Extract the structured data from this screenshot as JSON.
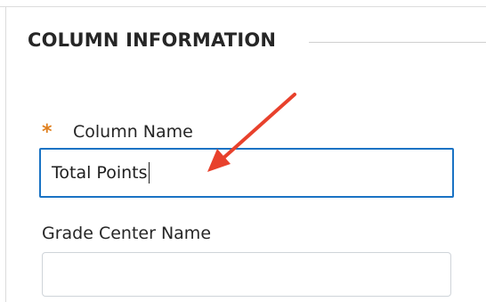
{
  "section": {
    "title": "COLUMN INFORMATION"
  },
  "fields": {
    "column_name": {
      "required_marker": "*",
      "label": "Column Name",
      "value": "Total Points"
    },
    "grade_center_name": {
      "label": "Grade Center Name",
      "value": ""
    }
  },
  "colors": {
    "required": "#e0801f",
    "focus_border": "#1a73c4",
    "annotation_arrow": "#e8412c"
  },
  "icons": {
    "annotation": "red-arrow-icon"
  }
}
